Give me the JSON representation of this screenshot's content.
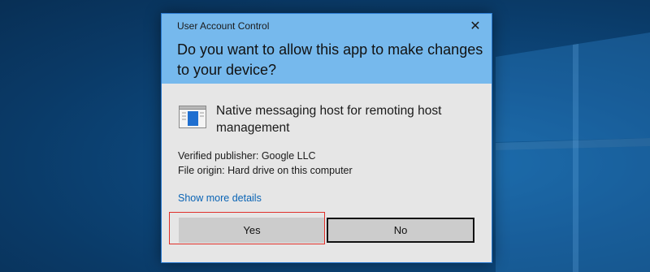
{
  "dialog": {
    "window_title": "User Account Control",
    "question": "Do you want to allow this app to make changes to your device?",
    "app_icon": "app-window-icon",
    "app_name": "Native messaging host for remoting host management",
    "publisher": "Verified publisher: Google LLC",
    "origin": "File origin: Hard drive on this computer",
    "details_link": "Show more details",
    "close_glyph": "✕"
  },
  "buttons": {
    "yes": "Yes",
    "no": "No"
  },
  "colors": {
    "header": "#76b9ed",
    "body": "#e6e6e6",
    "link": "#0a64b5",
    "highlight": "#e0302a"
  }
}
